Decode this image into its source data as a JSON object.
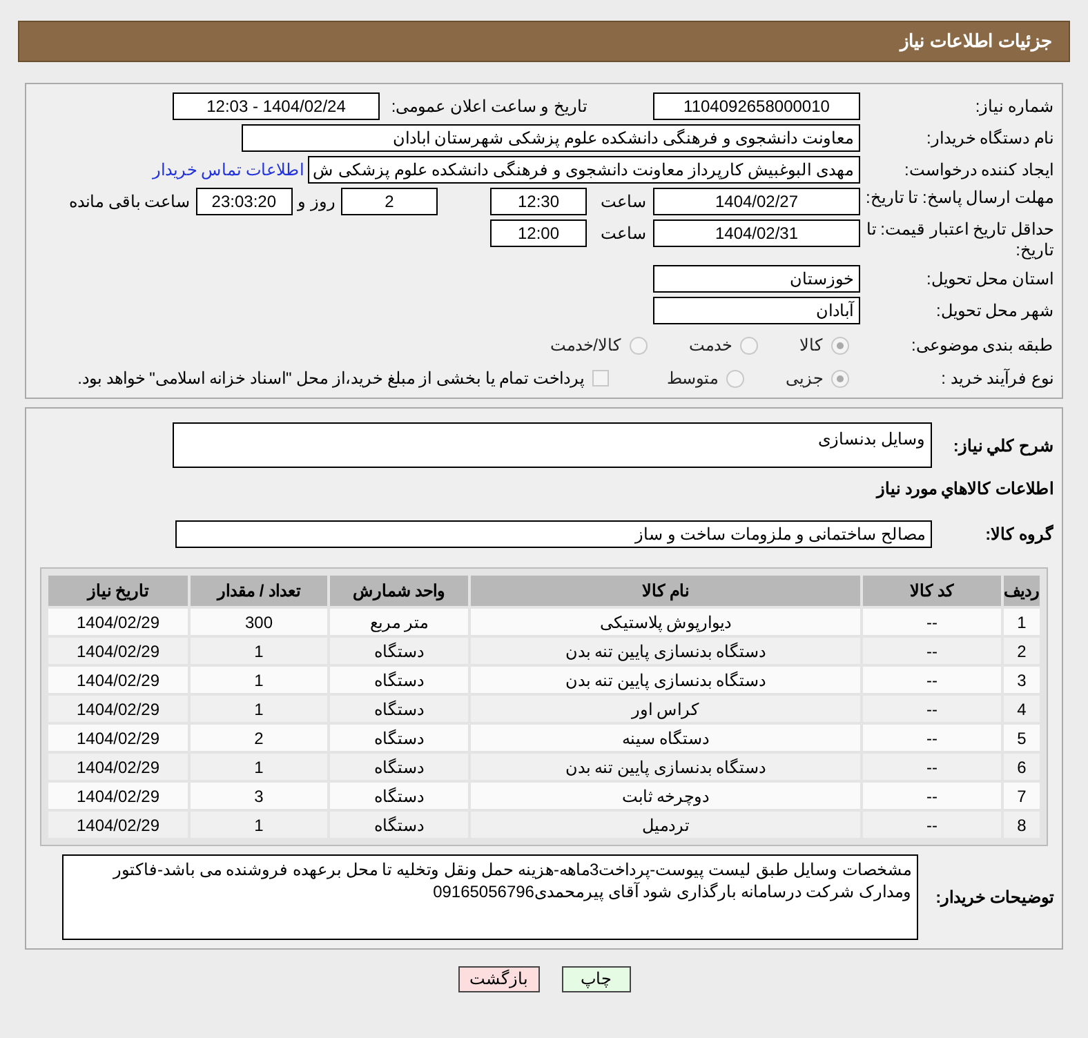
{
  "header": {
    "title": "جزئیات اطلاعات نیاز"
  },
  "need_number": {
    "label": "شماره نیاز:",
    "value": "1104092658000010"
  },
  "announce": {
    "label": "تاریخ و ساعت اعلان عمومی:",
    "value": "1404/02/24 - 12:03"
  },
  "buyer_org": {
    "label": "نام دستگاه خریدار:",
    "value": "معاونت دانشجوی و فرهنگی دانشکده علوم پزشکی شهرستان ابادان"
  },
  "creator": {
    "label": "ایجاد کننده درخواست:",
    "value": "مهدی البوغبیش کارپرداز معاونت دانشجوی و فرهنگی دانشکده علوم پزشکی ش",
    "link": "اطلاعات تماس خریدار"
  },
  "deadline": {
    "label": "مهلت ارسال پاسخ: تا تاریخ:",
    "date": "1404/02/27",
    "time_label": "ساعت",
    "time": "12:30",
    "days": "2",
    "days_label": "روز و",
    "remaining": "23:03:20",
    "remaining_label": "ساعت باقی مانده"
  },
  "price_validity": {
    "label": "حداقل تاریخ اعتبار قیمت: تا تاریخ:",
    "date": "1404/02/31",
    "time_label": "ساعت",
    "time": "12:00"
  },
  "province": {
    "label": "استان محل تحویل:",
    "value": "خوزستان"
  },
  "city": {
    "label": "شهر محل تحویل:",
    "value": "آبادان"
  },
  "category": {
    "label": "طبقه بندی موضوعی:",
    "options": [
      {
        "label": "کالا",
        "selected": true
      },
      {
        "label": "خدمت",
        "selected": false
      },
      {
        "label": "کالا/خدمت",
        "selected": false
      }
    ]
  },
  "purchase_type": {
    "label": "نوع فرآیند خرید :",
    "options": [
      {
        "label": "جزیی",
        "selected": true
      },
      {
        "label": "متوسط",
        "selected": false
      }
    ],
    "treasury": {
      "label": "پرداخت تمام یا بخشی از مبلغ خرید،از محل \"اسناد خزانه اسلامی\" خواهد بود.",
      "checked": false
    }
  },
  "description": {
    "label": "شرح كلي نياز:",
    "value": "وسایل بدنسازی"
  },
  "goods_title": "اطلاعات كالاهاي مورد نياز",
  "goods_group": {
    "label": "گروه کالا:",
    "value": "مصالح ساختمانی و ملزومات ساخت و ساز"
  },
  "table": {
    "columns": [
      "ردیف",
      "کد کالا",
      "نام کالا",
      "واحد شمارش",
      "تعداد / مقدار",
      "تاریخ نیاز"
    ],
    "rows": [
      [
        "1",
        "--",
        "دیوارپوش پلاستیکی",
        "متر مربع",
        "300",
        "1404/02/29"
      ],
      [
        "2",
        "--",
        "دستگاه بدنسازی پایین تنه بدن",
        "دستگاه",
        "1",
        "1404/02/29"
      ],
      [
        "3",
        "--",
        "دستگاه بدنسازی پایین تنه بدن",
        "دستگاه",
        "1",
        "1404/02/29"
      ],
      [
        "4",
        "--",
        "کراس اور",
        "دستگاه",
        "1",
        "1404/02/29"
      ],
      [
        "5",
        "--",
        "دستگاه سینه",
        "دستگاه",
        "2",
        "1404/02/29"
      ],
      [
        "6",
        "--",
        "دستگاه بدنسازی پایین تنه بدن",
        "دستگاه",
        "1",
        "1404/02/29"
      ],
      [
        "7",
        "--",
        "دوچرخه ثابت",
        "دستگاه",
        "3",
        "1404/02/29"
      ],
      [
        "8",
        "--",
        "تردمیل",
        "دستگاه",
        "1",
        "1404/02/29"
      ]
    ]
  },
  "buyer_notes": {
    "label": "توضیحات خریدار:",
    "value": "مشخصات وسایل طبق لیست پیوست-پرداخت3ماهه-هزینه حمل ونقل وتخلیه تا محل برعهده فروشنده می باشد-فاکتور ومدارک شرکت درسامانه بارگذاری شود آقای پیرمحمدی09165056796"
  },
  "buttons": [
    {
      "label": "چاپ",
      "kind": "print"
    },
    {
      "label": "بازگشت",
      "kind": "back"
    }
  ]
}
